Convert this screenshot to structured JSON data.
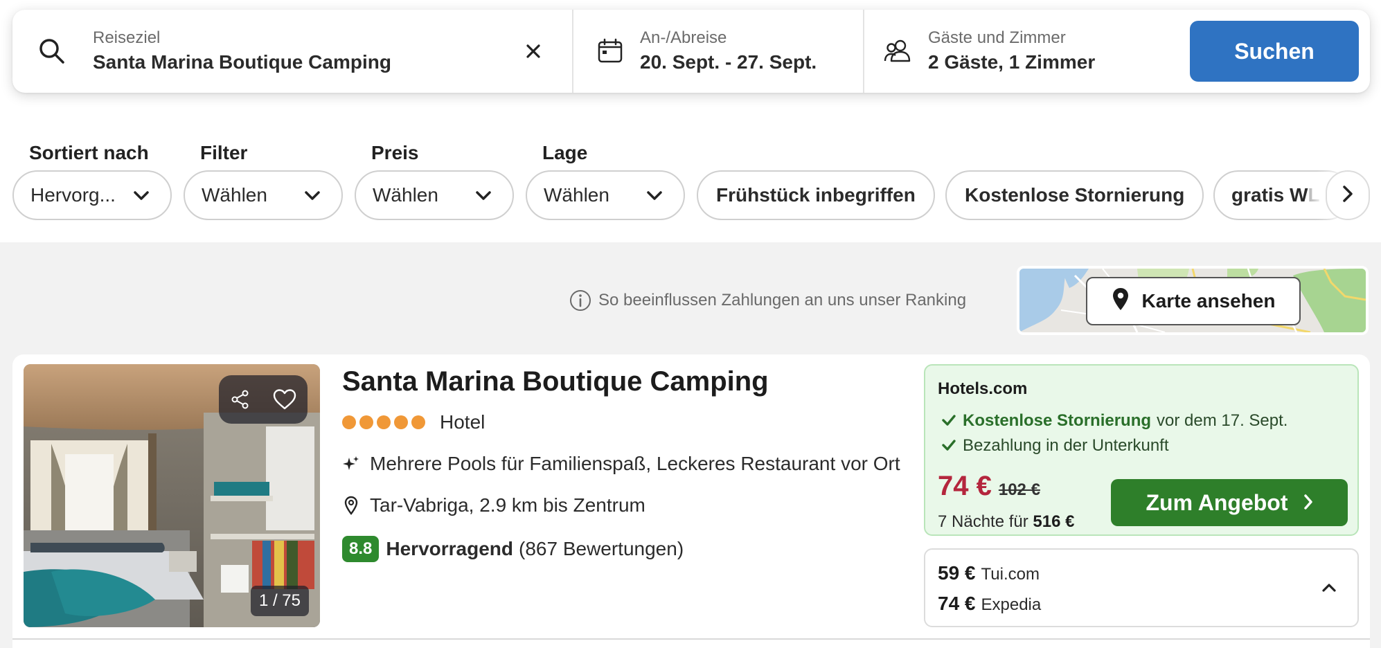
{
  "search": {
    "destination_label": "Reiseziel",
    "destination_value": "Santa Marina Boutique Camping",
    "dates_label": "An-/Abreise",
    "dates_value": "20. Sept. - 27. Sept.",
    "guests_label": "Gäste und Zimmer",
    "guests_value": "2 Gäste, 1 Zimmer",
    "search_button": "Suchen"
  },
  "filters": {
    "sort": {
      "label": "Sortiert nach",
      "value": "Hervorg..."
    },
    "filter": {
      "label": "Filter",
      "value": "Wählen"
    },
    "price": {
      "label": "Preis",
      "value": "Wählen"
    },
    "location": {
      "label": "Lage",
      "value": "Wählen"
    },
    "chips": [
      "Frühstück inbegriffen",
      "Kostenlose Stornierung"
    ],
    "chip_partial_visible": "gratis W",
    "chip_partial_faded": "L",
    "chip_partial_full": "gratis WLAN"
  },
  "ranking_note": "So beeinflussen Zahlungen an uns unser Ranking",
  "map": {
    "button": "Karte ansehen"
  },
  "hotel": {
    "name": "Santa Marina Boutique Camping",
    "stars": 5,
    "type": "Hotel",
    "highlights": "Mehrere Pools für Familienspaß, Leckeres Restaurant vor Ort",
    "location": "Tar-Vabriga, 2.9 km bis Zentrum",
    "rating_score": "8.8",
    "rating_word": "Hervorragend",
    "rating_count": "(867 Bewertungen)",
    "photo_counter": "1 / 75"
  },
  "offer": {
    "provider": "Hotels.com",
    "perk1_bold": "Kostenlose Stornierung",
    "perk1_rest": "vor dem 17. Sept.",
    "perk2": "Bezahlung in der Unterkunft",
    "price_now": "74 €",
    "price_old": "102 €",
    "nights_prefix": "7 Nächte für",
    "nights_total": "516 €",
    "button": "Zum Angebot"
  },
  "alternatives": [
    {
      "price": "59 €",
      "provider": "Tui.com"
    },
    {
      "price": "74 €",
      "provider": "Expedia"
    }
  ],
  "colors": {
    "primary": "#2f73c2",
    "deal_green": "#2e7f2a",
    "offer_bg": "#e9f8e9",
    "price_red": "#b4263d",
    "star_orange": "#f09837",
    "score_green": "#2e8a2e"
  }
}
